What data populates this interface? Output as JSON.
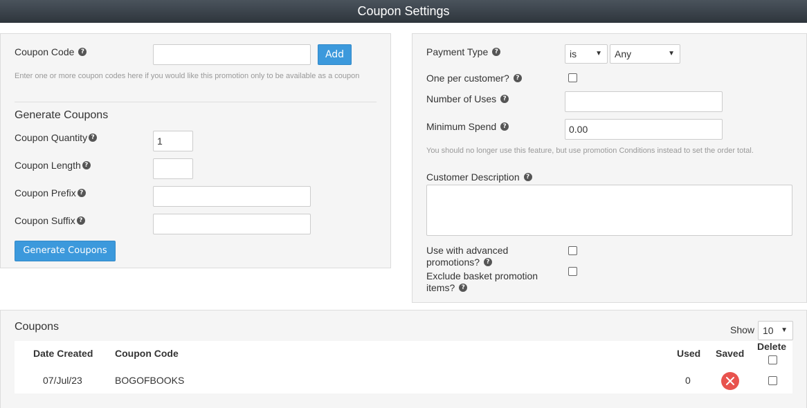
{
  "header": {
    "title": "Coupon Settings"
  },
  "left_panel": {
    "coupon_code": {
      "label": "Coupon Code",
      "value": "",
      "add_label": "Add",
      "hint": "Enter one or more coupon codes here if you would like this promotion only to be available as a coupon"
    },
    "generate": {
      "heading": "Generate Coupons",
      "quantity_label": "Coupon Quantity",
      "quantity_value": "1",
      "length_label": "Coupon Length",
      "length_value": "",
      "prefix_label": "Coupon Prefix",
      "prefix_value": "",
      "suffix_label": "Coupon Suffix",
      "suffix_value": "",
      "button_label": "Generate Coupons"
    }
  },
  "right_panel": {
    "payment_type": {
      "label": "Payment Type",
      "operator": "is",
      "value": "Any"
    },
    "one_per_customer": {
      "label": "One per customer?",
      "checked": false
    },
    "number_of_uses": {
      "label": "Number of Uses",
      "value": ""
    },
    "minimum_spend": {
      "label": "Minimum Spend",
      "value": "0.00",
      "hint": "You should no longer use this feature, but use promotion Conditions instead to set the order total."
    },
    "customer_description": {
      "label": "Customer Description",
      "value": ""
    },
    "use_advanced": {
      "label": "Use with advanced promotions?",
      "checked": false
    },
    "exclude_basket": {
      "label": "Exclude basket promotion items?",
      "checked": false
    }
  },
  "coupons": {
    "title": "Coupons",
    "show_label": "Show",
    "show_value": "10",
    "columns": {
      "date_created": "Date Created",
      "coupon_code": "Coupon Code",
      "used": "Used",
      "saved": "Saved",
      "delete": "Delete"
    },
    "rows": [
      {
        "date_created": "07/Jul/23",
        "coupon_code": "BOGOFBOOKS",
        "used": "0",
        "saved": false,
        "delete": false
      }
    ]
  },
  "colors": {
    "accent": "#3c99dc",
    "header_bg": "#363d44",
    "danger": "#e8534e"
  },
  "icons": {
    "help": "question-circle-icon",
    "saved_false": "x-circle-icon",
    "dropdown": "caret-down-icon"
  }
}
